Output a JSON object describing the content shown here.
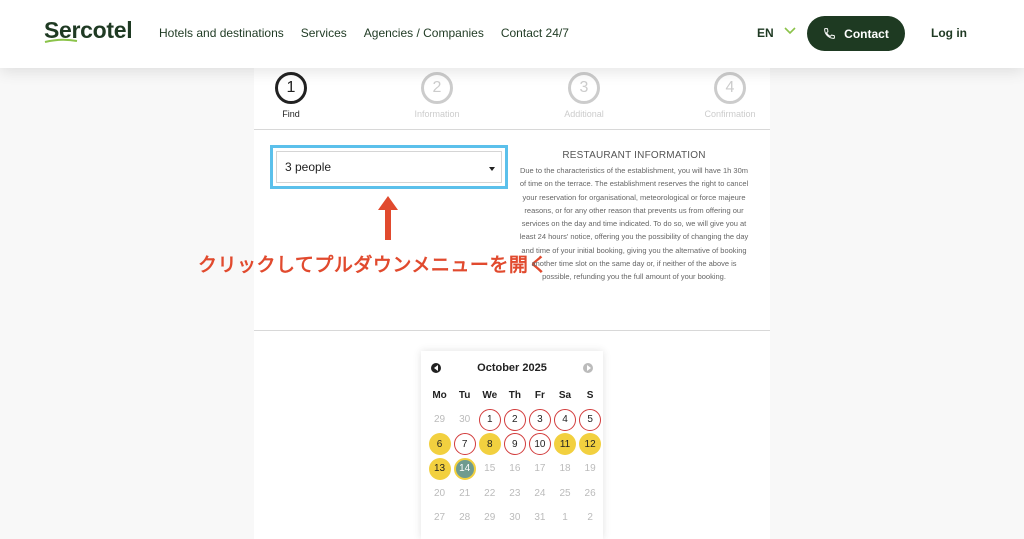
{
  "header": {
    "logo": "Sercotel",
    "nav": [
      "Hotels and destinations",
      "Services",
      "Agencies / Companies",
      "Contact 24/7"
    ],
    "lang": "EN",
    "contact_label": "Contact",
    "login_label": "Log in",
    "brand_color": "#1e3a22"
  },
  "steps": [
    {
      "num": "1",
      "label": "Find",
      "active": true
    },
    {
      "num": "2",
      "label": "Information",
      "active": false
    },
    {
      "num": "3",
      "label": "Additional",
      "active": false
    },
    {
      "num": "4",
      "label": "Confirmation",
      "active": false
    }
  ],
  "people_select": {
    "value": "3 people"
  },
  "annotation": {
    "text": "クリックしてプルダウンメニューを開く",
    "color": "#e14a2e"
  },
  "restaurant_info": {
    "title": "RESTAURANT INFORMATION",
    "text": "Due to the characteristics of the establishment, you will have 1h 30m of time on the terrace. The establishment reserves the right to cancel your reservation for organisational, meteorological or force majeure reasons, or for any other reason that prevents us from offering our services on the day and time indicated. To do so, we will give you at least 24 hours' notice, offering you the possibility of changing the day and time of your initial booking, giving you the alternative of booking another time slot on the same day or, if neither of the above is possible, refunding you the full amount of your booking."
  },
  "calendar": {
    "month_label": "October 2025",
    "weekdays": [
      "Mo",
      "Tu",
      "We",
      "Th",
      "Fr",
      "Sa",
      "S"
    ],
    "days": [
      {
        "d": "29",
        "s": "muted"
      },
      {
        "d": "30",
        "s": "muted"
      },
      {
        "d": "1",
        "s": "avail"
      },
      {
        "d": "2",
        "s": "avail"
      },
      {
        "d": "3",
        "s": "avail"
      },
      {
        "d": "4",
        "s": "avail"
      },
      {
        "d": "5",
        "s": "avail"
      },
      {
        "d": "6",
        "s": "yellow"
      },
      {
        "d": "7",
        "s": "avail"
      },
      {
        "d": "8",
        "s": "yellow"
      },
      {
        "d": "9",
        "s": "avail"
      },
      {
        "d": "10",
        "s": "avail"
      },
      {
        "d": "11",
        "s": "yellow"
      },
      {
        "d": "12",
        "s": "yellow"
      },
      {
        "d": "13",
        "s": "yellow"
      },
      {
        "d": "14",
        "s": "today"
      },
      {
        "d": "15",
        "s": "muted"
      },
      {
        "d": "16",
        "s": "muted"
      },
      {
        "d": "17",
        "s": "muted"
      },
      {
        "d": "18",
        "s": "muted"
      },
      {
        "d": "19",
        "s": "muted"
      },
      {
        "d": "20",
        "s": "muted"
      },
      {
        "d": "21",
        "s": "muted"
      },
      {
        "d": "22",
        "s": "muted"
      },
      {
        "d": "23",
        "s": "muted"
      },
      {
        "d": "24",
        "s": "muted"
      },
      {
        "d": "25",
        "s": "muted"
      },
      {
        "d": "26",
        "s": "muted"
      },
      {
        "d": "27",
        "s": "muted"
      },
      {
        "d": "28",
        "s": "muted"
      },
      {
        "d": "29",
        "s": "muted"
      },
      {
        "d": "30",
        "s": "muted"
      },
      {
        "d": "31",
        "s": "muted"
      },
      {
        "d": "1",
        "s": "muted"
      },
      {
        "d": "2",
        "s": "muted"
      }
    ]
  }
}
